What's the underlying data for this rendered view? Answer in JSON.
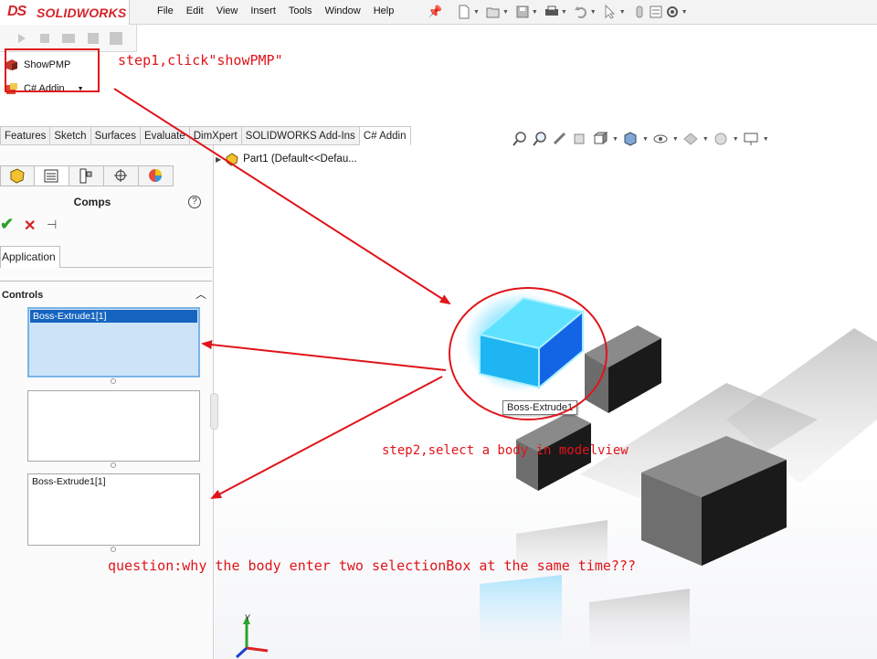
{
  "app": {
    "brand_prefix": "DS",
    "brand": "SOLIDWORKS"
  },
  "menu": [
    "File",
    "Edit",
    "View",
    "Insert",
    "Tools",
    "Window",
    "Help"
  ],
  "addin_menu": {
    "show_pmp": "ShowPMP",
    "csharp_addin": "C# Addin"
  },
  "tabs": [
    "Features",
    "Sketch",
    "Surfaces",
    "Evaluate",
    "DimXpert",
    "SOLIDWORKS Add-Ins",
    "C# Addin"
  ],
  "active_tab": "C# Addin",
  "tree": {
    "root": "Part1  (Default<<Defau..."
  },
  "property_manager": {
    "title": "Comps",
    "group_tab": "Application",
    "controls_label": "Controls",
    "selection_boxes": [
      {
        "items": [
          "Boss-Extrude1[1]"
        ],
        "active": true
      },
      {
        "items": [],
        "active": false
      },
      {
        "items": [
          "Boss-Extrude1[1]"
        ],
        "active": false
      }
    ]
  },
  "viewport": {
    "tooltip": "Boss-Extrude1"
  },
  "annotations": {
    "step1": "step1,click\"showPMP\"",
    "step2": "step2,select a body in modelview",
    "question": "question:why the body enter two selectionBox at the same time???"
  },
  "colors": {
    "annotation": "#e0141a",
    "brand": "#d3252b",
    "selection": "#1565c0",
    "selected_body": "#2bc8ff"
  },
  "icons": [
    "new-document-icon",
    "open-icon",
    "save-icon",
    "print-icon",
    "undo-icon",
    "select-icon",
    "rebuild-icon",
    "file-properties-icon",
    "options-icon"
  ]
}
